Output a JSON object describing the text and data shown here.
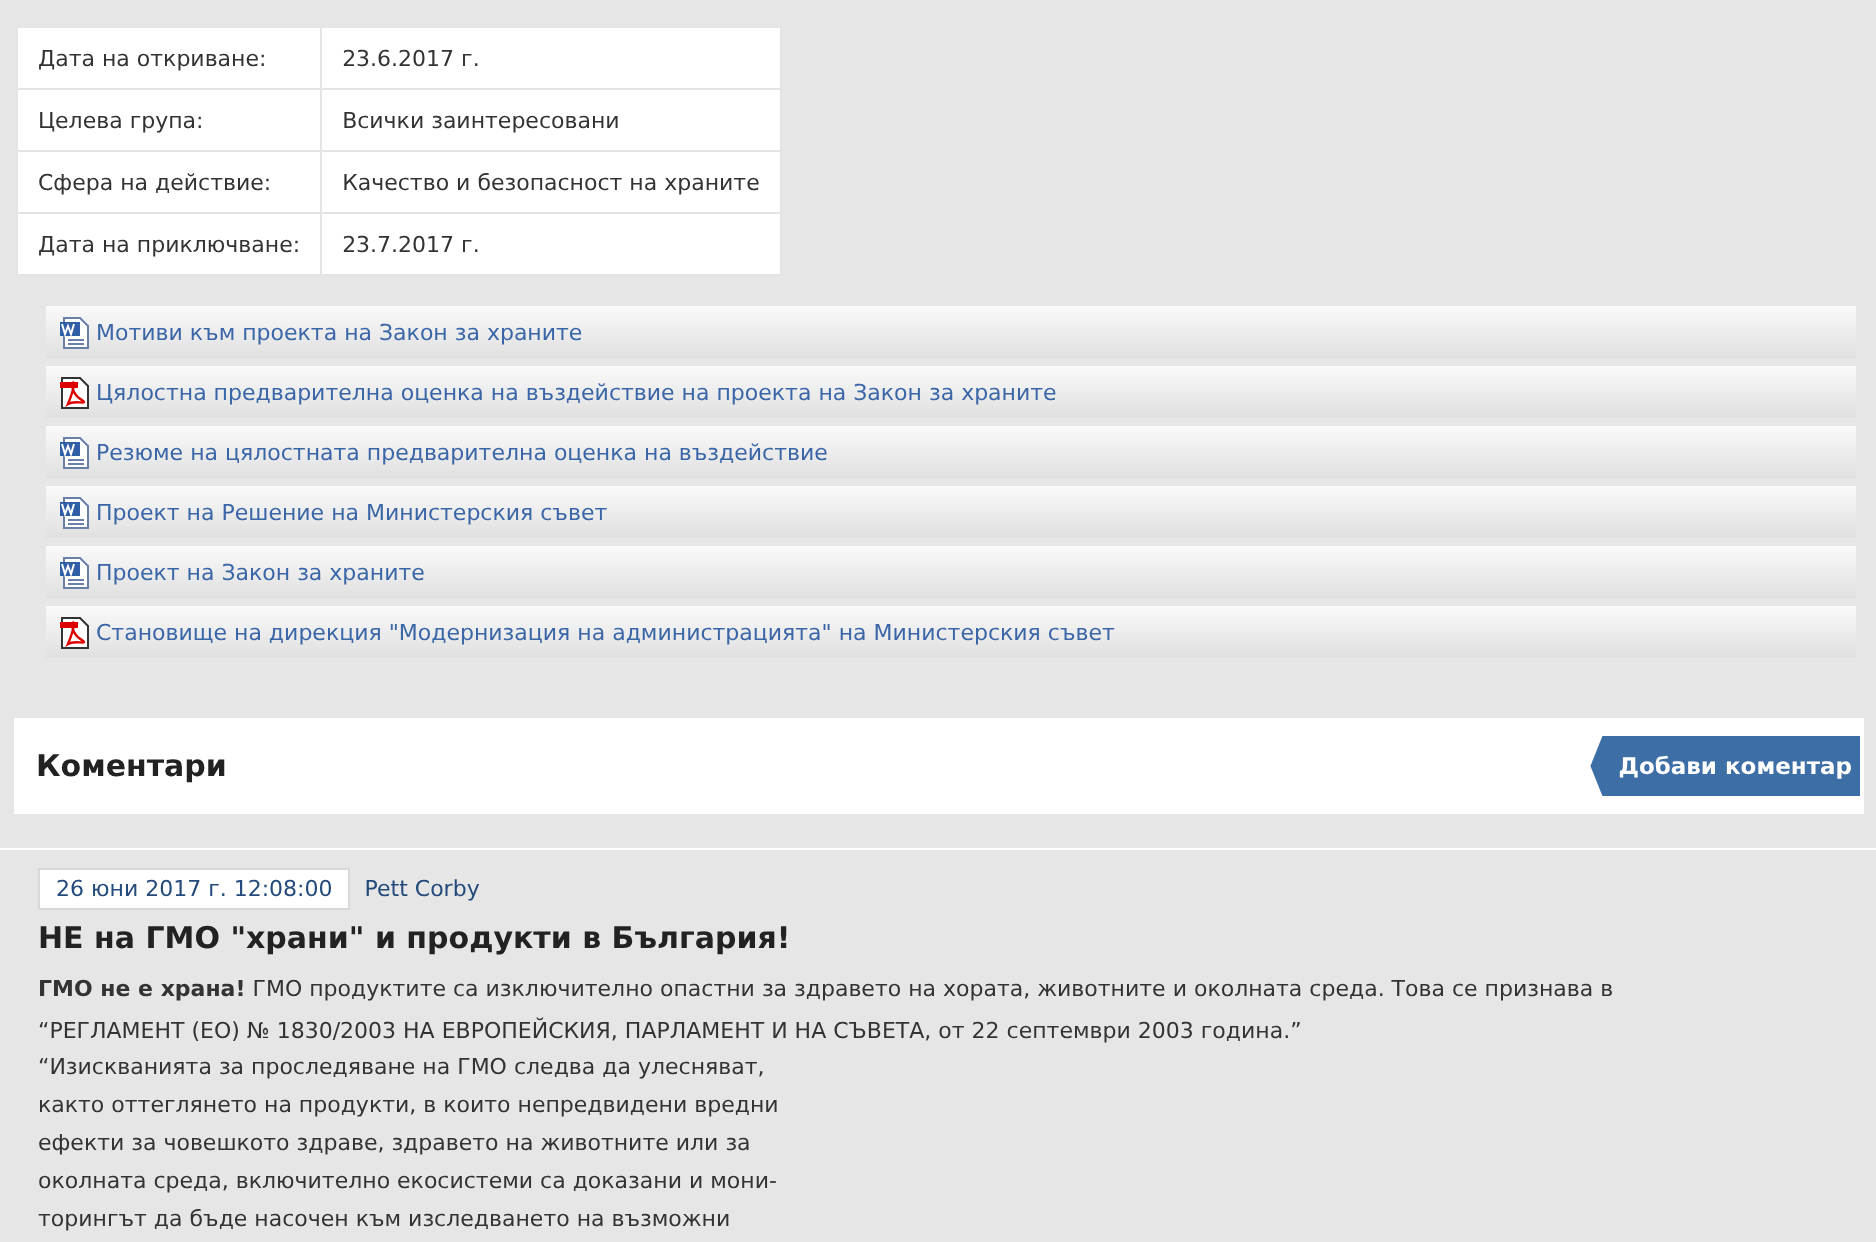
{
  "details": [
    {
      "label": "Дата на откриване:",
      "value": "23.6.2017 г."
    },
    {
      "label": "Целева група:",
      "value": "Всички заинтересовани"
    },
    {
      "label": "Сфера на действие:",
      "value": "Качество и безопасност на храните"
    },
    {
      "label": "Дата на приключване:",
      "value": "23.7.2017 г."
    }
  ],
  "documents": [
    {
      "kind": "word",
      "title": "Мотиви към проекта на Закон за храните"
    },
    {
      "kind": "pdf",
      "title": "Цялостна предварителна оценка на въздействие на проекта на Закон за храните"
    },
    {
      "kind": "word",
      "title": "Резюме на цялостната предварителна оценка на въздействие"
    },
    {
      "kind": "word",
      "title": "Проект на Решение на Министерския съвет"
    },
    {
      "kind": "word",
      "title": "Проект на Закон за храните"
    },
    {
      "kind": "pdf",
      "title": "Становище на дирекция \"Модернизация на администрацията\" на Министерския съвет"
    }
  ],
  "comments_header": {
    "title": "Коментари",
    "add_button": "Добави коментар"
  },
  "comments": [
    {
      "date": "26 юни 2017 г. 12:08:00",
      "author": "Pett Corby",
      "title": "НЕ на ГМО \"храни\" и продукти в България!",
      "paragraph_lines": [
        "**ГМО не е храна!** ГМО продуктите са изключително опастни за здравето на хората, животните и околната среда. Това се признава в",
        "“РЕГЛАМЕНТ (ЕО) № 1830/2003 НА ЕВРОПЕЙСКИЯ, ПАРЛАМЕНТ И НА СЪВЕТА, от 22 септември 2003 година.”"
      ],
      "quote_lines": [
        "“Изискванията за проследяване на ГМО следва да улесняват,",
        "както оттеглянето на продукти, в които непредвидени вредни",
        "ефекти за човешкото здраве, здравето на животните или за",
        "околната среда, включително екосистеми са доказани и мони-",
        "торингът да бъде насочен към изследването на възможни"
      ]
    }
  ]
}
